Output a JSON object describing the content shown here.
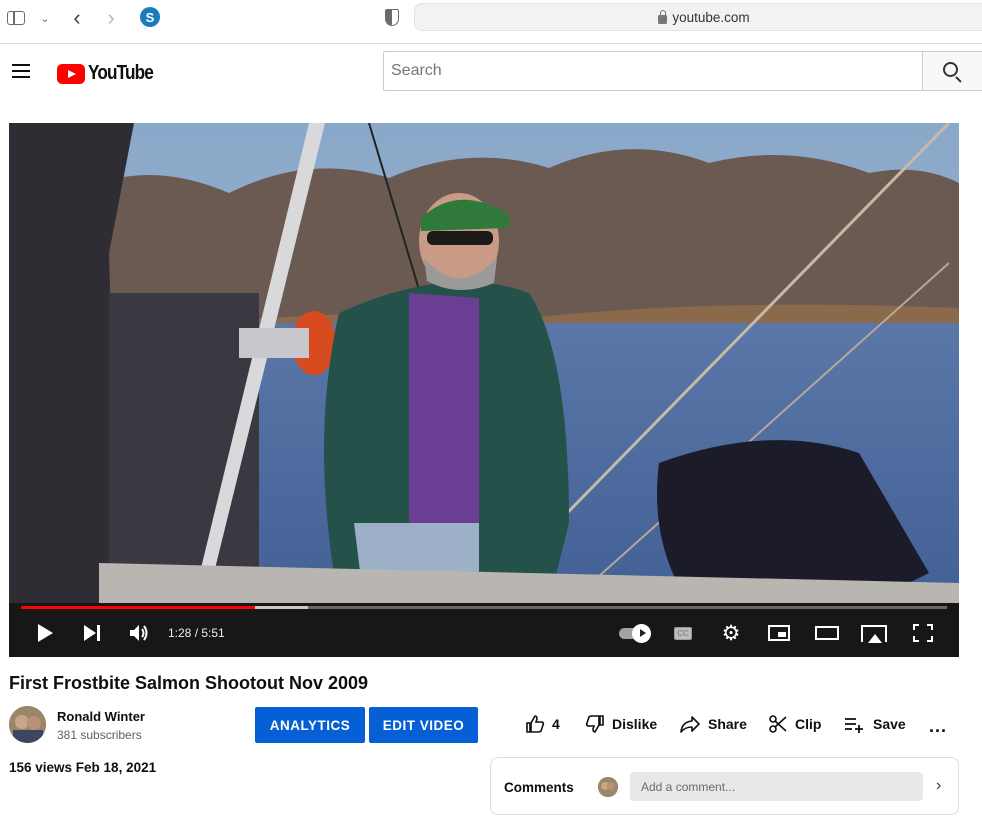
{
  "browser": {
    "url": "youtube.com",
    "extension_letter": "S",
    "icons": [
      "sidebar-icon",
      "chevron-down-icon",
      "back-icon",
      "forward-icon",
      "extension-icon",
      "shield-icon",
      "lock-icon"
    ]
  },
  "header": {
    "logo_text": "YouTube",
    "search_placeholder": "Search"
  },
  "player": {
    "time_display": "1:28 / 5:51",
    "progress_played_fraction": 0.253,
    "buffer_fraction": 0.31,
    "cc_label": "CC",
    "accent_color": "#ff0000"
  },
  "video": {
    "title": "First Frostbite Salmon Shootout Nov 2009",
    "channel_name": "Ronald Winter",
    "subscribers": "381 subscribers",
    "views_date": "156 views  Feb 18, 2021"
  },
  "buttons": {
    "analytics": "ANALYTICS",
    "edit_video": "EDIT VIDEO",
    "primary_color": "#065fd4"
  },
  "actions": {
    "like_count": "4",
    "dislike": "Dislike",
    "share": "Share",
    "clip": "Clip",
    "save": "Save",
    "more": "..."
  },
  "comments": {
    "label": "Comments",
    "placeholder": "Add a comment..."
  }
}
